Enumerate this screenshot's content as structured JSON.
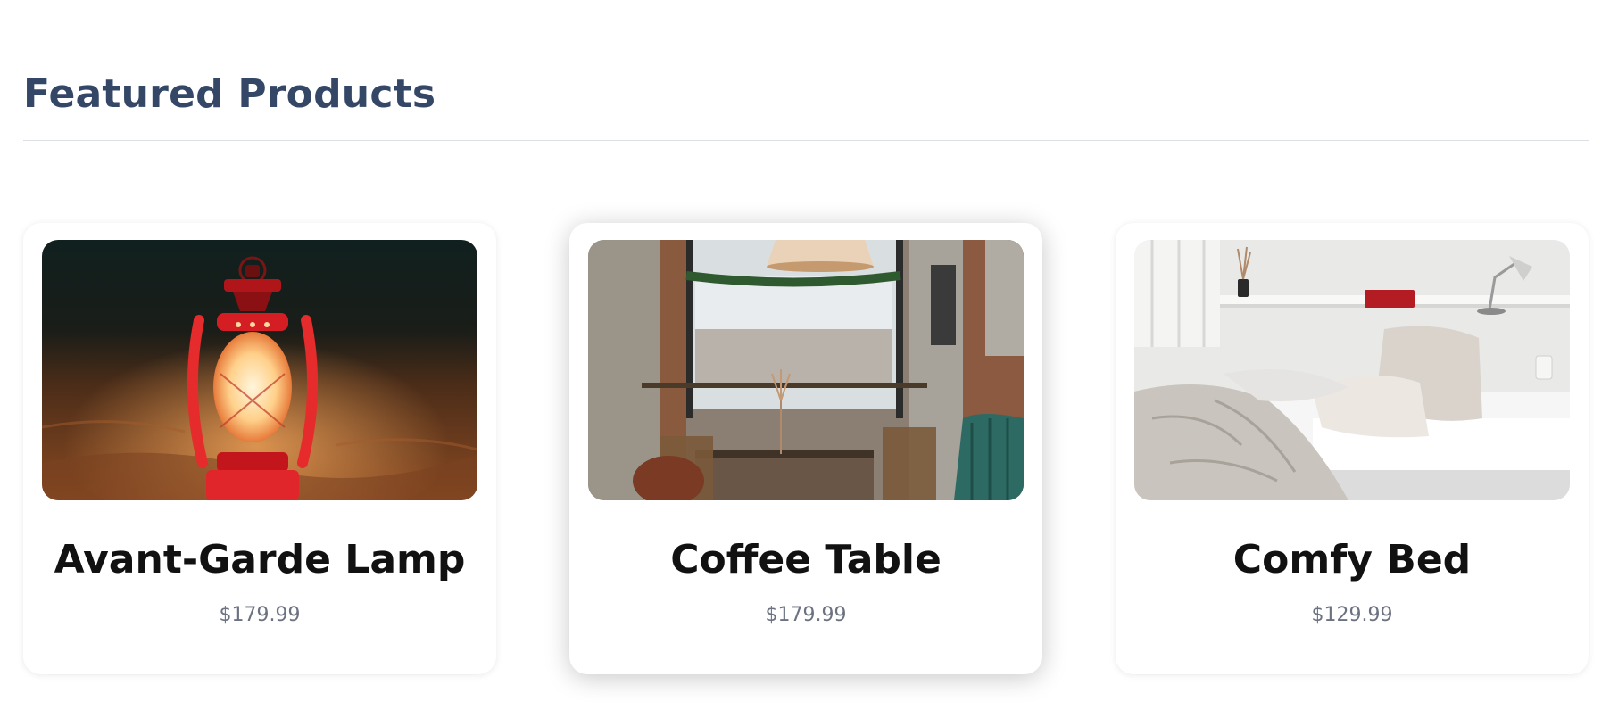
{
  "section": {
    "title": "Featured Products"
  },
  "products": [
    {
      "name": "Avant-Garde Lamp",
      "price": "$179.99",
      "image": "red-lantern-on-sand-image"
    },
    {
      "name": "Coffee Table",
      "price": "$179.99",
      "image": "cafe-interior-image"
    },
    {
      "name": "Comfy Bed",
      "price": "$129.99",
      "image": "white-bedroom-image"
    }
  ],
  "colors": {
    "title": "#344767",
    "price": "#6b7280",
    "divider": "#dcdfe4"
  }
}
